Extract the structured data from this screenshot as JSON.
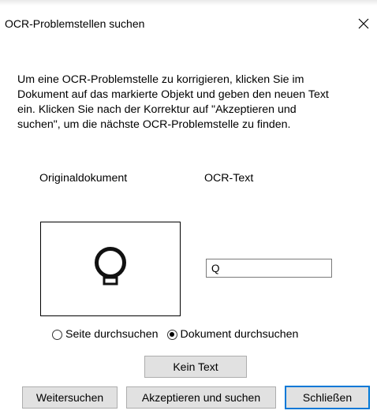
{
  "dialog": {
    "title": "OCR-Problemstellen suchen",
    "instructions": "Um eine OCR-Problemstelle zu korrigieren, klicken Sie im\nDokument auf das markierte Objekt und geben den neuen Text\nein. Klicken Sie nach der Korrektur auf \"Akzeptieren und\nsuchen\", um die nächste OCR-Problemstelle zu finden.",
    "labels": {
      "original": "Originaldokument",
      "ocr_text": "OCR-Text"
    },
    "ocr_value": "Q",
    "search_scope": {
      "options": [
        "Seite durchsuchen",
        "Dokument durchsuchen"
      ],
      "selected": "Dokument durchsuchen"
    },
    "buttons": {
      "no_text": "Kein Text",
      "next": "Weitersuchen",
      "accept": "Akzeptieren und suchen",
      "close": "Schließen"
    },
    "icons": {
      "close": "close-icon",
      "preview_glyph": "lightbulb-glyph"
    },
    "colors": {
      "default_button_border": "#0078d7",
      "button_bg": "#e1e1e1"
    }
  }
}
